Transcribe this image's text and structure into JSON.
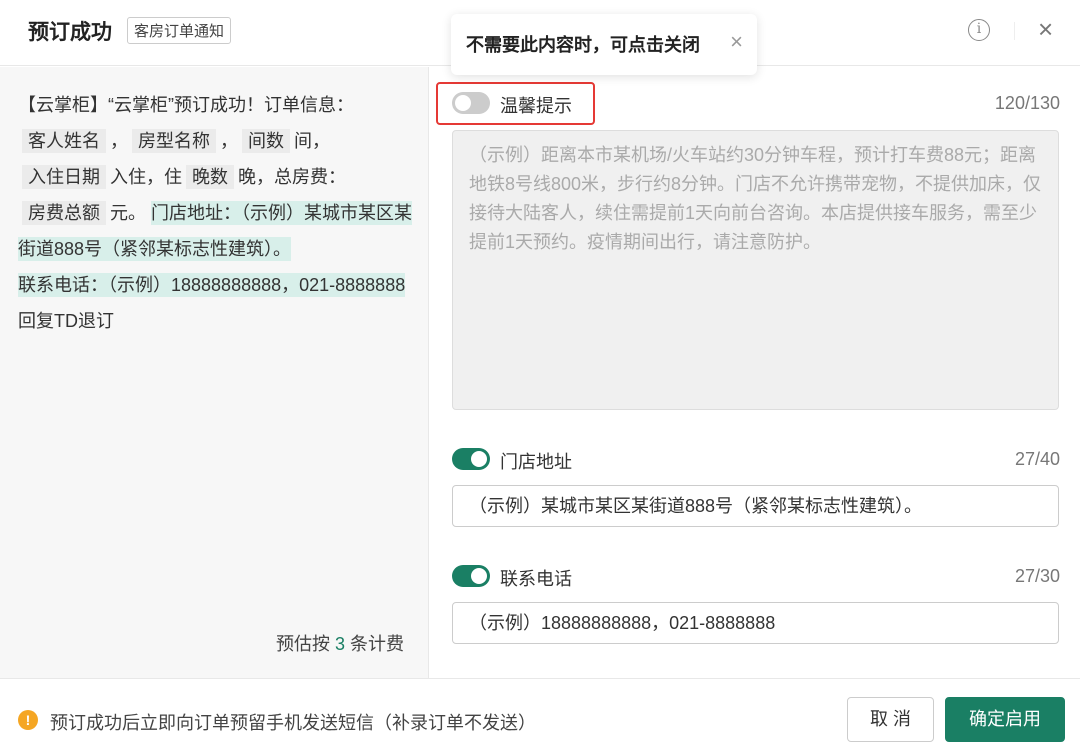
{
  "header": {
    "title": "预订成功",
    "badge": "客房订单通知",
    "info_icon": "i",
    "close_icon": "×"
  },
  "preview": {
    "prefix": "【云掌柜】“云掌柜”预订成功！订单信息：",
    "guest": "客人姓名",
    "sep1": "，",
    "room_type": "房型名称",
    "sep2": "，",
    "rooms": "间数",
    "rooms_unit": "间，",
    "checkin": "入住日期",
    "checkin_text": "入住，住",
    "nights": "晚数",
    "nights_text": "晚，总房费：",
    "total": "房费总额",
    "yuan": "元。",
    "address": " 门店地址：（示例）某城市某区某街道888号（紧邻某标志性建筑）。",
    "phone": " 联系电话：（示例）18888888888，021-8888888 ",
    "suffix": "回复TD退订",
    "estimate_pre": "预估按",
    "estimate_n": "3",
    "estimate_post": "条计费"
  },
  "tooltip": {
    "text": "不需要此内容时，可点击关闭",
    "close": "×"
  },
  "fields": [
    {
      "label": "温馨提示",
      "enabled": false,
      "count": "120/130",
      "value": "（示例）距离本市某机场/火车站约30分钟车程，预计打车费88元；距离地铁8号线800米，步行约8分钟。门店不允许携带宠物，不提供加床，仅接待大陆客人，续住需提前1天向前台咨询。本店提供接车服务，需至少提前1天预约。疫情期间出行，请注意防护。"
    },
    {
      "label": "门店地址",
      "enabled": true,
      "count": "27/40",
      "value": "（示例）某城市某区某街道888号（紧邻某标志性建筑）。"
    },
    {
      "label": "联系电话",
      "enabled": true,
      "count": "27/30",
      "value": "（示例）18888888888，021-8888888"
    }
  ],
  "footer": {
    "warn_icon": "!",
    "note": "预订成功后立即向订单预留手机发送短信（补录订单不发送）",
    "cancel": "取 消",
    "confirm": "确定启用"
  }
}
